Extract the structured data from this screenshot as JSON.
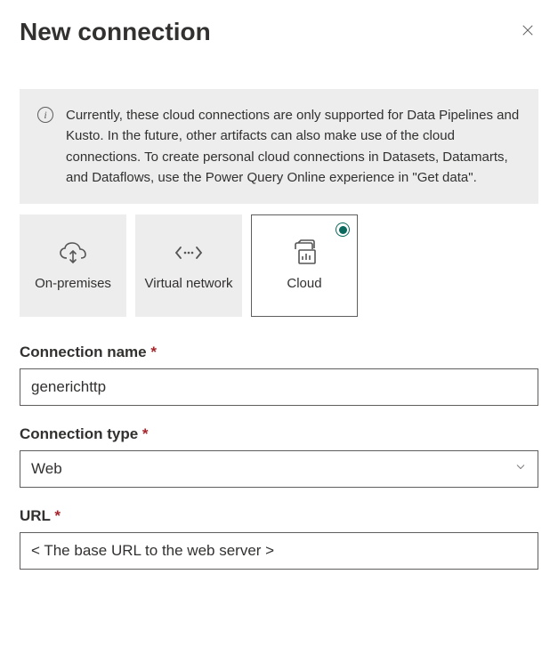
{
  "header": {
    "title": "New connection"
  },
  "info_banner": {
    "text": "Currently, these cloud connections are only supported for Data Pipelines and Kusto. In the future, other artifacts can also make use of the cloud connections. To create personal cloud connections in Datasets, Datamarts, and Dataflows, use the Power Query Online experience in \"Get data\"."
  },
  "tiles": {
    "onprem": "On-premises",
    "vnet": "Virtual network",
    "cloud": "Cloud"
  },
  "form": {
    "connection_name_label": "Connection name",
    "connection_name_value": "generichttp",
    "connection_type_label": "Connection type",
    "connection_type_value": "Web",
    "url_label": "URL",
    "url_placeholder": "< The base URL to the web server >"
  }
}
